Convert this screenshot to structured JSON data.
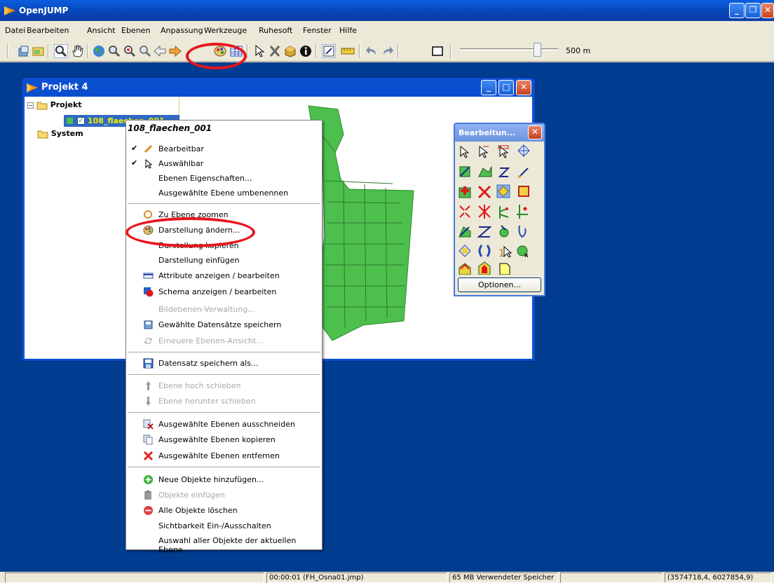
{
  "app": {
    "title": "OpenJUMP"
  },
  "menubar": {
    "items": [
      "Datei",
      "Bearbeiten",
      "Ansicht",
      "Ebenen",
      "Anpassung",
      "Werkzeuge",
      "Ruhesoft",
      "Fenster",
      "Hilfe"
    ]
  },
  "toolbar": {
    "scale_label": "500 m",
    "zoom_slider_level": 0.76
  },
  "project": {
    "title": "Projekt 4",
    "tree": {
      "root": "Projekt",
      "layer": "108_flaechen_001",
      "system": "System"
    }
  },
  "context_menu": {
    "title": "108_flaechen_001",
    "items": [
      {
        "label": "Bearbeitbar",
        "checked": true,
        "icon": "pencil-icon",
        "disabled": false
      },
      {
        "label": "Auswählbar",
        "checked": true,
        "icon": "arrow-pointer-icon",
        "disabled": false
      },
      {
        "label": "Ebenen Eigenschaften...",
        "disabled": false
      },
      {
        "label": "Ausgewählte Ebene umbenennen",
        "disabled": false
      },
      {
        "label": "Zu Ebene zoomen",
        "icon": "zoom-layer-icon",
        "disabled": false
      },
      {
        "label": "Darstellung ändern...",
        "icon": "palette-icon",
        "disabled": false
      },
      {
        "label": "Darstellung kopieren",
        "disabled": false
      },
      {
        "label": "Darstellung einfügen",
        "disabled": false
      },
      {
        "label": "Attribute anzeigen / bearbeiten",
        "icon": "table-icon",
        "disabled": false
      },
      {
        "label": "Schema anzeigen / bearbeiten",
        "icon": "schema-icon",
        "disabled": false
      },
      {
        "label": "Bildebenen-Verwaltung...",
        "disabled": true
      },
      {
        "label": "Gewählte Datensätze speichern",
        "icon": "save-selected-icon",
        "disabled": false
      },
      {
        "label": "Erneuere Ebenen-Ansicht...",
        "icon": "refresh-icon",
        "disabled": true
      },
      {
        "label": "Datensatz speichern als...",
        "icon": "floppy-icon",
        "disabled": false
      },
      {
        "label": "Ebene hoch schieben",
        "icon": "arrow-up-icon",
        "disabled": true
      },
      {
        "label": "Ebene herunter schieben",
        "icon": "arrow-down-icon",
        "disabled": true
      },
      {
        "label": "Ausgewählte Ebenen ausschneiden",
        "icon": "cut-icon",
        "disabled": false
      },
      {
        "label": "Ausgewählte Ebenen kopieren",
        "icon": "copy-icon",
        "disabled": false
      },
      {
        "label": "Ausgewählte Ebenen entfernen",
        "icon": "delete-x-icon",
        "disabled": false
      },
      {
        "label": "Neue Objekte hinzufügen...",
        "icon": "add-circle-icon",
        "disabled": false
      },
      {
        "label": "Objekte einfügen",
        "icon": "paste-icon",
        "disabled": true
      },
      {
        "label": "Alle Objekte löschen",
        "icon": "remove-circle-icon",
        "disabled": false
      },
      {
        "label": "Sichtbarkeit Ein-/Ausschalten",
        "disabled": false
      },
      {
        "label": "Auswahl aller Objekte der aktuellen Ebene",
        "disabled": false
      }
    ]
  },
  "palette": {
    "title": "Bearbeitun...",
    "options_label": "Optionen..."
  },
  "statusbar": {
    "time": "00:00:01 (FH_Osna01.jmp)",
    "memory": "65 MB Verwendeter Speicher",
    "coords": "(3574718,4, 6027854,9)"
  },
  "colors": {
    "desktop": "#003c8f",
    "map_fill": "#4cbf4c",
    "highlight": "#e8141c",
    "selection": "#316ac5"
  }
}
